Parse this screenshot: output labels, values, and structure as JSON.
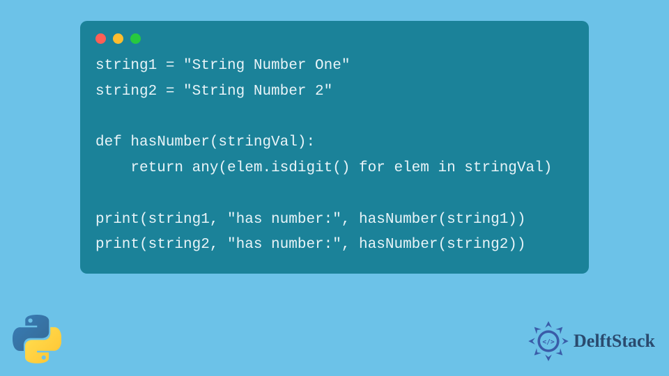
{
  "code": {
    "lines": [
      "string1 = \"String Number One\"",
      "string2 = \"String Number 2\"",
      "",
      "def hasNumber(stringVal):",
      "    return any(elem.isdigit() for elem in stringVal)",
      "",
      "print(string1, \"has number:\", hasNumber(string1))",
      "print(string2, \"has number:\", hasNumber(string2))"
    ]
  },
  "branding": {
    "site_name": "DelftStack"
  }
}
